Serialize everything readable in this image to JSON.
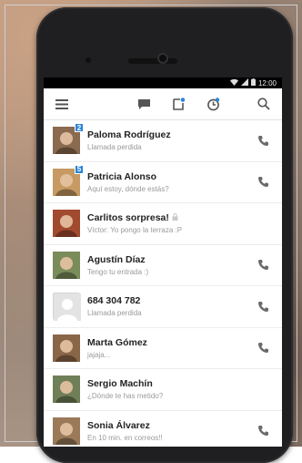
{
  "status_bar": {
    "time": "12:00"
  },
  "toolbar": {
    "menu_icon": "menu-icon",
    "chat_icon": "chat-icon",
    "note_icon": "note-icon",
    "clock_icon": "recent-icon",
    "search_icon": "search-icon"
  },
  "contacts": [
    {
      "name": "Paloma Rodríguez",
      "subtitle": "Llamada perdida",
      "badge": "2",
      "has_call": true,
      "avatar_color": "#8b6b4f"
    },
    {
      "name": "Patricia Alonso",
      "subtitle": "Aquí estoy, dónde estás?",
      "badge": "5",
      "has_call": true,
      "avatar_color": "#c69a62"
    },
    {
      "name": "Carlitos sorpresa!",
      "subtitle": "Víctor: Yo pongo la terraza :P",
      "badge": "",
      "has_call": false,
      "avatar_color": "#a14a2f",
      "locked": true
    },
    {
      "name": "Agustín Díaz",
      "subtitle": "Tengo tu entrada :)",
      "badge": "",
      "has_call": true,
      "avatar_color": "#7a8c5a"
    },
    {
      "name": "684 304 782",
      "subtitle": "Llamada perdida",
      "badge": "",
      "has_call": true,
      "avatar_color": "#d6d6d6"
    },
    {
      "name": "Marta Gómez",
      "subtitle": "jajaja...",
      "badge": "",
      "has_call": true,
      "avatar_color": "#8a6648"
    },
    {
      "name": "Sergio Machín",
      "subtitle": "¿Dónde te has metido?",
      "badge": "",
      "has_call": false,
      "avatar_color": "#6f7f57"
    },
    {
      "name": "Sonia Álvarez",
      "subtitle": "En 10 min. en correos!!",
      "badge": "",
      "has_call": true,
      "avatar_color": "#9a7a58"
    }
  ],
  "colors": {
    "accent": "#2c85d8",
    "icon": "#555555"
  }
}
